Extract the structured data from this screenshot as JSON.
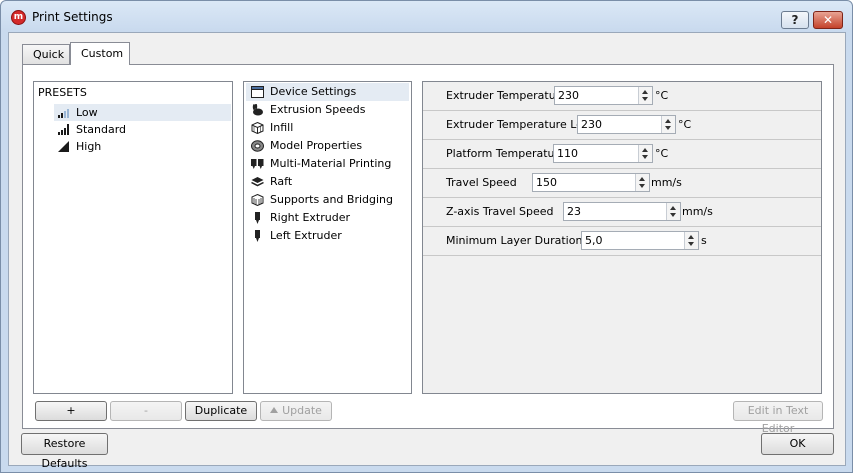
{
  "window": {
    "title": "Print Settings",
    "app_icon": "makerbot-logo-icon",
    "help_label": "?",
    "close_label": "✕"
  },
  "tabs": [
    {
      "label": "Quick",
      "active": false
    },
    {
      "label": "Custom",
      "active": true
    }
  ],
  "presets": {
    "header": "PRESETS",
    "items": [
      {
        "label": "Low",
        "icon": "signal-low-icon",
        "selected": true
      },
      {
        "label": "Standard",
        "icon": "signal-medium-icon",
        "selected": false
      },
      {
        "label": "High",
        "icon": "signal-high-icon",
        "selected": false
      }
    ],
    "buttons": {
      "add": "+",
      "remove": "-",
      "duplicate": "Duplicate",
      "update": "Update"
    }
  },
  "categories": [
    {
      "label": "Device Settings",
      "icon": "window-icon",
      "selected": true
    },
    {
      "label": "Extrusion Speeds",
      "icon": "rabbit-icon",
      "selected": false
    },
    {
      "label": "Infill",
      "icon": "cube-icon",
      "selected": false
    },
    {
      "label": "Model Properties",
      "icon": "donut-icon",
      "selected": false
    },
    {
      "label": "Multi-Material Printing",
      "icon": "dual-extruder-icon",
      "selected": false
    },
    {
      "label": "Raft",
      "icon": "layers-icon",
      "selected": false
    },
    {
      "label": "Supports and Bridging",
      "icon": "support-cube-icon",
      "selected": false
    },
    {
      "label": "Right Extruder",
      "icon": "extruder-icon",
      "selected": false
    },
    {
      "label": "Left Extruder",
      "icon": "extruder-icon",
      "selected": false
    }
  ],
  "settings": [
    {
      "label": "Extruder Temperature",
      "value": "230",
      "unit": "°C"
    },
    {
      "label": "Extruder Temperature Left",
      "value": "230",
      "unit": "°C"
    },
    {
      "label": "Platform Temperature",
      "value": "110",
      "unit": "°C"
    },
    {
      "label": "Travel Speed",
      "value": "150",
      "unit": "mm/s"
    },
    {
      "label": "Z-axis Travel Speed",
      "value": "23",
      "unit": "mm/s"
    },
    {
      "label": "Minimum Layer Duration",
      "value": "5,0",
      "unit": "s"
    }
  ],
  "footer": {
    "edit_in_text_editor": "Edit in Text Editor",
    "restore_defaults": "Restore Defaults",
    "ok": "OK"
  }
}
